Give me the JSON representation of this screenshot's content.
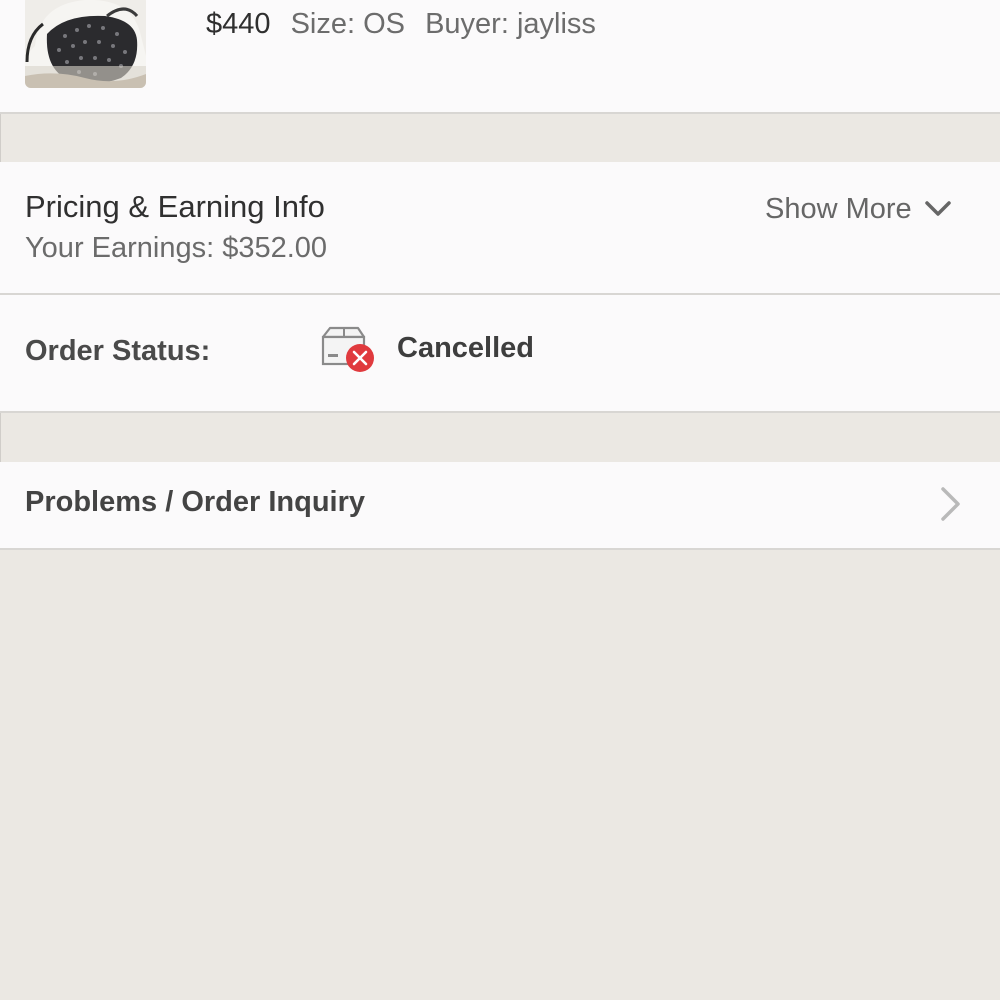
{
  "listing": {
    "price": "$440",
    "size": "Size: OS",
    "buyer": "Buyer: jayliss",
    "thumbnail_icon": "bag-photo-thumbnail"
  },
  "pricing": {
    "title": "Pricing & Earning Info",
    "earnings": "Your Earnings: $352.00",
    "show_more_label": "Show More",
    "chevron_icon": "chevron-down-icon"
  },
  "order_status": {
    "label": "Order Status:",
    "value": "Cancelled",
    "icon": "package-cancelled-icon",
    "icon_accent": "#e03a3e"
  },
  "inquiry": {
    "label": "Problems / Order Inquiry",
    "chevron_icon": "chevron-right-icon"
  },
  "colors": {
    "background": "#ebe8e3",
    "card": "#fbfafb",
    "divider": "#d8d6d3"
  }
}
